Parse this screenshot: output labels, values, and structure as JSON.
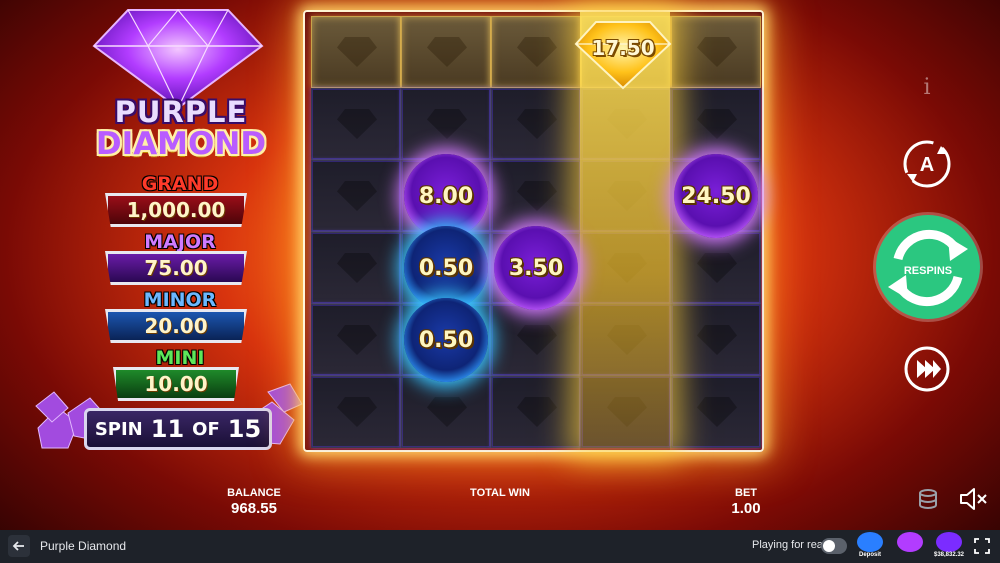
{
  "title": {
    "line1": "PURPLE",
    "line2": "DIAMOND"
  },
  "jackpots": {
    "grand": {
      "label": "GRAND",
      "value": "1,000.00"
    },
    "major": {
      "label": "MAJOR",
      "value": "75.00"
    },
    "minor": {
      "label": "MINOR",
      "value": "20.00"
    },
    "mini": {
      "label": "MINI",
      "value": "10.00"
    }
  },
  "spin_counter": {
    "word_spin": "SPIN",
    "current": "11",
    "word_of": "OF",
    "total": "15"
  },
  "grid": {
    "columns": 5,
    "rows": 6,
    "gold_prize": "17.50",
    "orbs": [
      {
        "value": "8.00",
        "color": "purple",
        "col": 2,
        "row": 3
      },
      {
        "value": "24.50",
        "color": "purple",
        "col": 5,
        "row": 3
      },
      {
        "value": "0.50",
        "color": "blue",
        "col": 2,
        "row": 4
      },
      {
        "value": "3.50",
        "color": "purple",
        "col": 3,
        "row": 4
      },
      {
        "value": "0.50",
        "color": "blue",
        "col": 2,
        "row": 5
      }
    ]
  },
  "controls": {
    "info_icon": "i",
    "auto_icon_letter": "A",
    "respins_label": "RESPINS"
  },
  "stats": {
    "balance_label": "BALANCE",
    "balance_value": "968.55",
    "total_win_label": "TOTAL WIN",
    "bet_label": "BET",
    "bet_value": "1.00"
  },
  "bottom_bar": {
    "game_name": "Purple Diamond",
    "playing_for_real": "Playing for real",
    "promos": [
      {
        "caption": "Deposit",
        "color": "#2a7fff"
      },
      {
        "caption": "",
        "color": "#b23cff"
      },
      {
        "caption": "$38,832.32",
        "color": "#7b2cff"
      }
    ]
  },
  "colors": {
    "respin_button": "#2bc780",
    "bar_bg": "#1e2229"
  }
}
